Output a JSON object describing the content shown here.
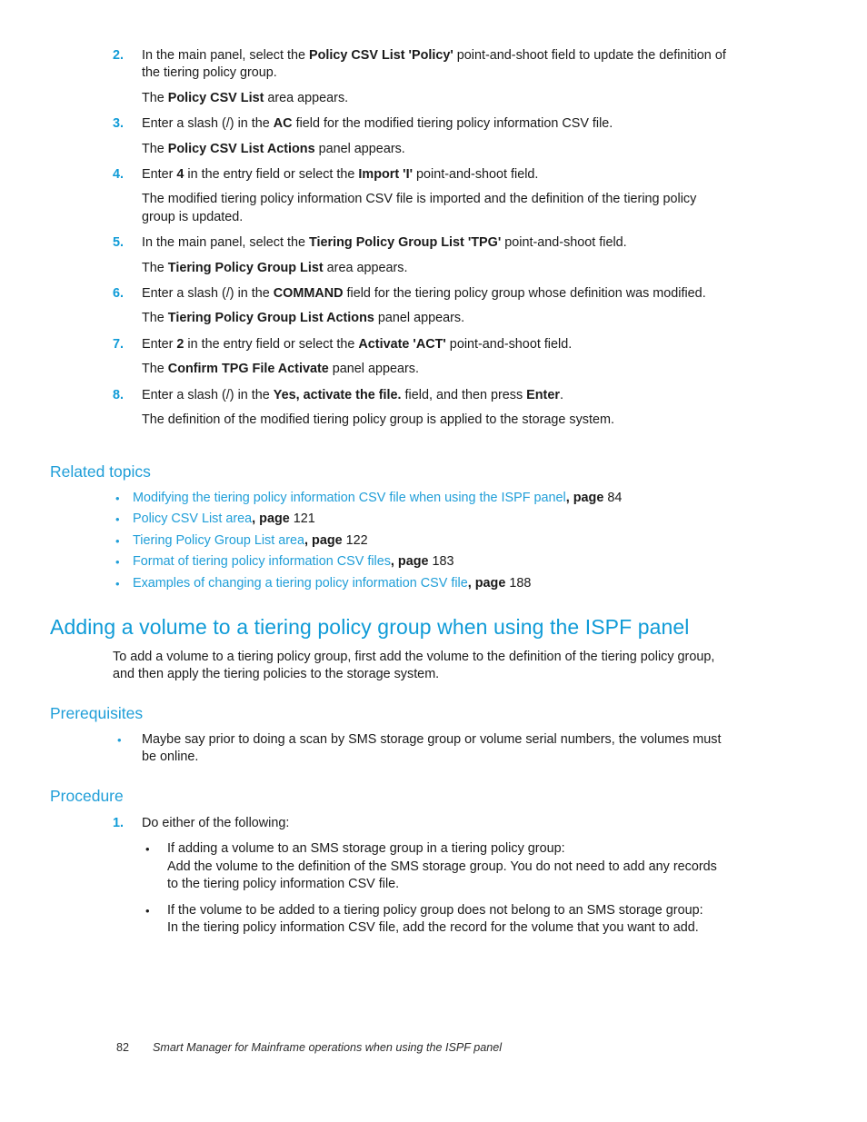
{
  "document": {
    "page_number": "82",
    "footer_title": "Smart Manager for Mainframe operations when using the ISPF panel"
  },
  "procedure_top": {
    "steps": [
      {
        "num": "2.",
        "text_parts": [
          {
            "t": "In the main panel, select the ",
            "bold": false
          },
          {
            "t": "Policy CSV List 'Policy'",
            "bold": true
          },
          {
            "t": " point-and-shoot field to update the definition of the tiering policy group.",
            "bold": false
          }
        ],
        "result_parts": [
          {
            "t": "The ",
            "bold": false
          },
          {
            "t": "Policy CSV List",
            "bold": true
          },
          {
            "t": " area appears.",
            "bold": false
          }
        ]
      },
      {
        "num": "3.",
        "text_parts": [
          {
            "t": "Enter a slash (/) in the ",
            "bold": false
          },
          {
            "t": "AC",
            "bold": true
          },
          {
            "t": " field for the modified tiering policy information CSV file.",
            "bold": false
          }
        ],
        "result_parts": [
          {
            "t": "The ",
            "bold": false
          },
          {
            "t": "Policy CSV List Actions",
            "bold": true
          },
          {
            "t": " panel appears.",
            "bold": false
          }
        ]
      },
      {
        "num": "4.",
        "text_parts": [
          {
            "t": "Enter ",
            "bold": false
          },
          {
            "t": "4",
            "bold": true
          },
          {
            "t": " in the entry field or select the ",
            "bold": false
          },
          {
            "t": "Import 'I'",
            "bold": true
          },
          {
            "t": " point-and-shoot field.",
            "bold": false
          }
        ],
        "result_parts": [
          {
            "t": "The modified tiering policy information CSV file is imported and the definition of the tiering policy group is updated.",
            "bold": false
          }
        ]
      },
      {
        "num": "5.",
        "text_parts": [
          {
            "t": "In the main panel, select the ",
            "bold": false
          },
          {
            "t": "Tiering Policy Group List 'TPG'",
            "bold": true
          },
          {
            "t": " point-and-shoot field.",
            "bold": false
          }
        ],
        "result_parts": [
          {
            "t": "The ",
            "bold": false
          },
          {
            "t": "Tiering Policy Group List",
            "bold": true
          },
          {
            "t": " area appears.",
            "bold": false
          }
        ]
      },
      {
        "num": "6.",
        "text_parts": [
          {
            "t": "Enter a slash (/) in the ",
            "bold": false
          },
          {
            "t": "COMMAND",
            "bold": true
          },
          {
            "t": " field for the tiering policy group whose definition was modified.",
            "bold": false
          }
        ],
        "result_parts": [
          {
            "t": "The ",
            "bold": false
          },
          {
            "t": "Tiering Policy Group List Actions",
            "bold": true
          },
          {
            "t": " panel appears.",
            "bold": false
          }
        ]
      },
      {
        "num": "7.",
        "text_parts": [
          {
            "t": "Enter ",
            "bold": false
          },
          {
            "t": "2",
            "bold": true
          },
          {
            "t": " in the entry field or select the ",
            "bold": false
          },
          {
            "t": "Activate 'ACT'",
            "bold": true
          },
          {
            "t": " point-and-shoot field.",
            "bold": false
          }
        ],
        "result_parts": [
          {
            "t": "The ",
            "bold": false
          },
          {
            "t": "Confirm TPG File Activate",
            "bold": true
          },
          {
            "t": " panel appears.",
            "bold": false
          }
        ]
      },
      {
        "num": "8.",
        "text_parts": [
          {
            "t": "Enter a slash (/) in the ",
            "bold": false
          },
          {
            "t": "Yes, activate the file.",
            "bold": true
          },
          {
            "t": " field, and then press ",
            "bold": false
          },
          {
            "t": "Enter",
            "bold": true
          },
          {
            "t": ".",
            "bold": false
          }
        ],
        "result_parts": [
          {
            "t": "The definition of the modified tiering policy group is applied to the storage system.",
            "bold": false
          }
        ]
      }
    ]
  },
  "related_topics": {
    "heading": "Related topics",
    "items": [
      {
        "link": "Modifying the tiering policy information CSV file when using the ISPF panel",
        "page_label": "page",
        "page": "84"
      },
      {
        "link": "Policy CSV List area",
        "page_label": "page",
        "page": "121"
      },
      {
        "link": "Tiering Policy Group List area",
        "page_label": "page",
        "page": "122"
      },
      {
        "link": "Format of tiering policy information CSV files",
        "page_label": "page",
        "page": "183"
      },
      {
        "link": "Examples of changing a tiering policy information CSV file",
        "page_label": "page",
        "page": "188"
      }
    ]
  },
  "section": {
    "title": "Adding a volume to a tiering policy group when using the ISPF panel",
    "intro": "To add a volume to a tiering policy group, first add the volume to the definition of the tiering policy group, and then apply the tiering policies to the storage system.",
    "prerequisites": {
      "heading": "Prerequisites",
      "items": [
        "Maybe say prior to doing a scan by SMS storage group or volume serial numbers, the volumes must be online."
      ]
    },
    "procedure": {
      "heading": "Procedure",
      "steps": [
        {
          "num": "1.",
          "text": "Do either of the following:",
          "sub_items": [
            {
              "title": "If adding a volume to an SMS storage group in a tiering policy group:",
              "body": "Add the volume to the definition of the SMS storage group. You do not need to add any records to the tiering policy information CSV file."
            },
            {
              "title": "If the volume to be added to a tiering policy group does not belong to an SMS storage group:",
              "body": "In the tiering policy information CSV file, add the record for the volume that you want to add."
            }
          ]
        }
      ]
    }
  },
  "colors": {
    "accent_blue": "#0f9bd7",
    "heading_blue": "#1f9ed8",
    "body": "#1a1a1a"
  }
}
